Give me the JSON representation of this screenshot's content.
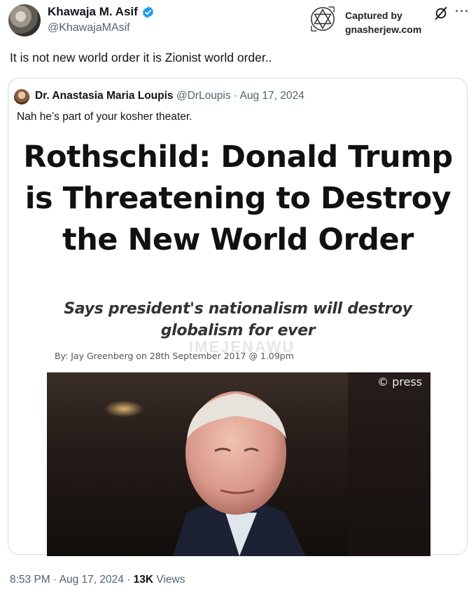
{
  "author": {
    "display_name": "Khawaja M. Asif",
    "handle": "@KhawajaMAsif"
  },
  "watermark": {
    "line1": "Captured by",
    "line2": "gnasherjew.com"
  },
  "tweet": {
    "text": "It is not new world order it is Zionist world order.."
  },
  "quoted": {
    "display_name": "Dr. Anastasia Maria Loupis",
    "meta": "@DrLoupis · Aug 17, 2024",
    "text": "Nah he’s part of your kosher theater.",
    "image": {
      "headline": "Rothschild: Donald Trump is Threatening to Destroy the New World Order",
      "subhead": "Says president's nationalism will destroy globalism for ever",
      "byline": "By: Jay Greenberg on 28th September 2017 @ 1.09pm",
      "faint_watermark": "IMEJENAWU",
      "photo_credit": "© press"
    }
  },
  "footer": {
    "time_date": "8:53 PM · Aug 17, 2024 · ",
    "views_count": "13K",
    "views_label": " Views"
  },
  "colors": {
    "verified": "#1d9bf0",
    "secondary_text": "#536471",
    "border": "#cfd9de"
  }
}
